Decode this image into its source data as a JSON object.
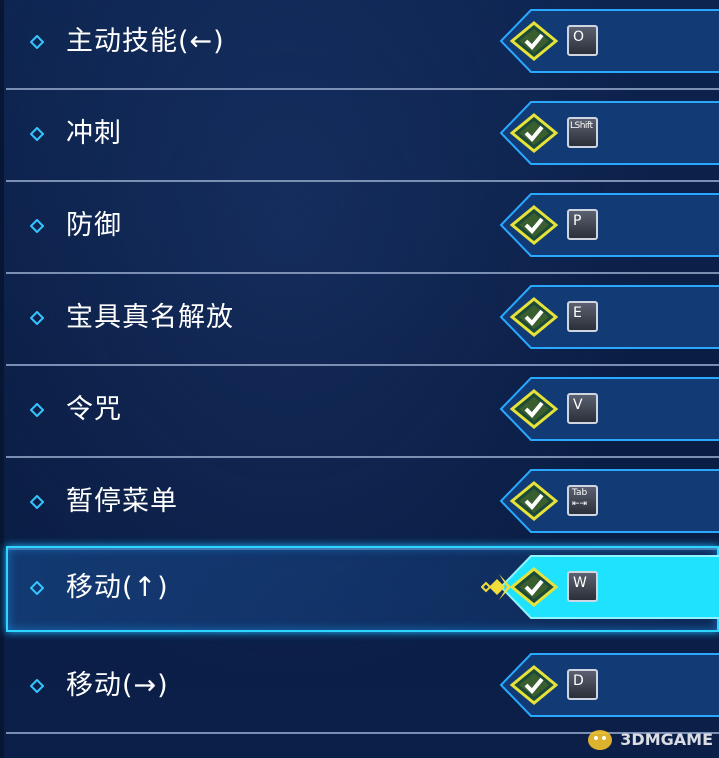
{
  "bindings": [
    {
      "action": "主动技能(←)",
      "key": "O",
      "key_style": "normal",
      "selected": false
    },
    {
      "action": "冲刺",
      "key": "LShift",
      "key_style": "small",
      "selected": false
    },
    {
      "action": "防御",
      "key": "P",
      "key_style": "normal",
      "selected": false
    },
    {
      "action": "宝具真名解放",
      "key": "E",
      "key_style": "normal",
      "selected": false
    },
    {
      "action": "令咒",
      "key": "V",
      "key_style": "normal",
      "selected": false
    },
    {
      "action": "暂停菜单",
      "key": "Tab",
      "key_style": "tab",
      "selected": false
    },
    {
      "action": "移动(↑)",
      "key": "W",
      "key_style": "normal",
      "selected": true
    },
    {
      "action": "移动(→)",
      "key": "D",
      "key_style": "normal",
      "selected": false
    }
  ],
  "tab_arrow": "⇤⇥",
  "watermark": "3DMGAME",
  "colors": {
    "background": "#0b1f48",
    "bullet": "#35c6ff",
    "slot_border": "#2aa8ff",
    "check_fill": "#e6e23a",
    "selected_slot": "#1fe2ff",
    "cursor": "#f2dd3a"
  },
  "icons": {
    "row_bullet": "diamond-bullet-icon",
    "confirm": "check-diamond-icon",
    "cursor": "selection-cursor-icon"
  }
}
